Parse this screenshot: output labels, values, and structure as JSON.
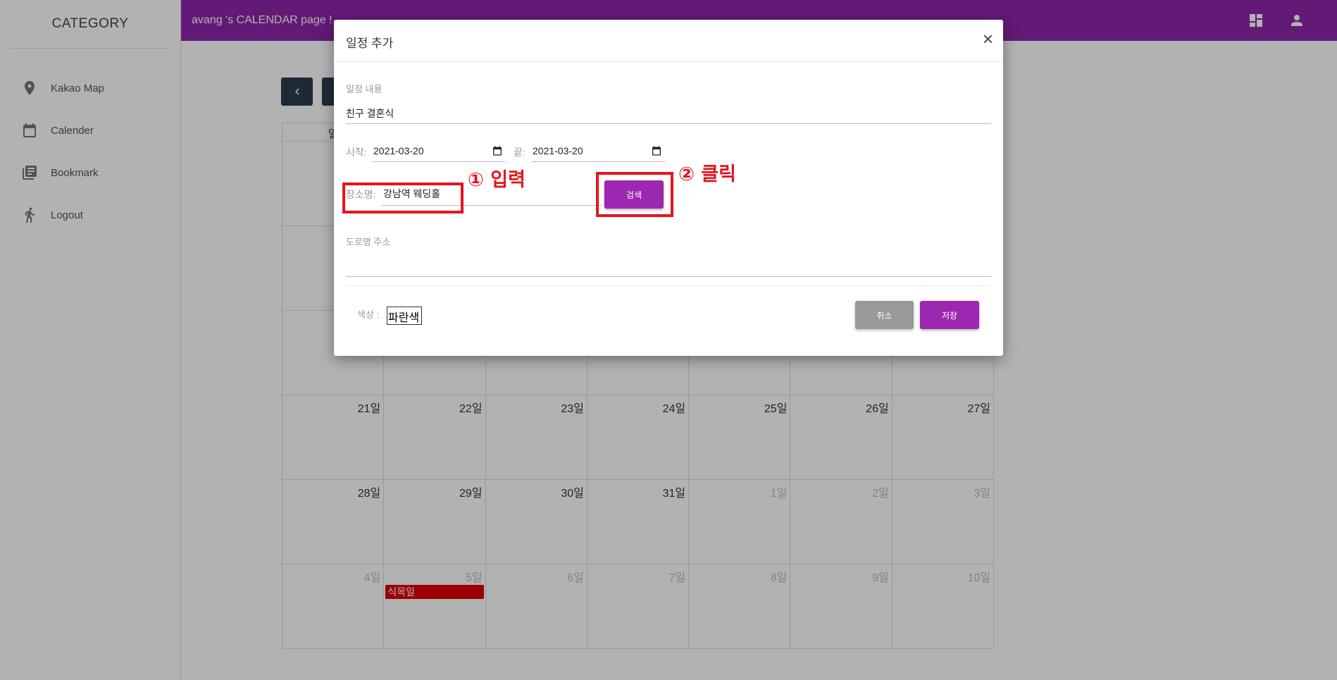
{
  "sidebar": {
    "title": "CATEGORY",
    "items": [
      {
        "label": "Kakao Map",
        "icon": "map-marker-icon"
      },
      {
        "label": "Calender",
        "icon": "calendar-icon"
      },
      {
        "label": "Bookmark",
        "icon": "bookmark-library-icon"
      },
      {
        "label": "Logout",
        "icon": "running-person-icon"
      }
    ]
  },
  "topbar": {
    "title": "avang 's CALENDAR page !",
    "icons": [
      "dashboard-icon",
      "account-icon"
    ],
    "color": "#8e24aa"
  },
  "calendar": {
    "weekday_header_visible": "일",
    "weeks": [
      [
        {
          "d": "21일"
        },
        {
          "d": "22일"
        },
        {
          "d": "23일"
        },
        {
          "d": "24일"
        },
        {
          "d": "25일"
        },
        {
          "d": "26일"
        },
        {
          "d": "27일"
        }
      ],
      [
        {
          "d": "28일"
        },
        {
          "d": "29일"
        },
        {
          "d": "30일"
        },
        {
          "d": "31일"
        },
        {
          "d": "1일",
          "dim": true
        },
        {
          "d": "2일",
          "dim": true
        },
        {
          "d": "3일",
          "dim": true
        }
      ],
      [
        {
          "d": "4일",
          "dim": true
        },
        {
          "d": "5일",
          "dim": true
        },
        {
          "d": "6일",
          "dim": true
        },
        {
          "d": "7일",
          "dim": true
        },
        {
          "d": "8일",
          "dim": true
        },
        {
          "d": "9일",
          "dim": true
        },
        {
          "d": "10일",
          "dim": true
        }
      ]
    ],
    "event": {
      "title": "식목일",
      "color": "#e00000"
    }
  },
  "dialog": {
    "title": "일정 추가",
    "close": "×",
    "content_label": "일정 내용",
    "content_value": "친구 결혼식",
    "start_label": "시작:",
    "start_value": "2021-03-20",
    "end_label": "끝:",
    "end_value": "2021-03-20",
    "place_label": "장소명:",
    "place_value": "강남역 웨딩홀",
    "search_button": "검색",
    "address_label": "도로명 주소",
    "color_label": "색상 :",
    "color_value": "파란색",
    "cancel_button": "취소",
    "save_button": "저장",
    "accent": "#9c27b0"
  },
  "annotations": {
    "step1": "① 입력",
    "step2": "② 클릭",
    "color": "#e8121f"
  }
}
